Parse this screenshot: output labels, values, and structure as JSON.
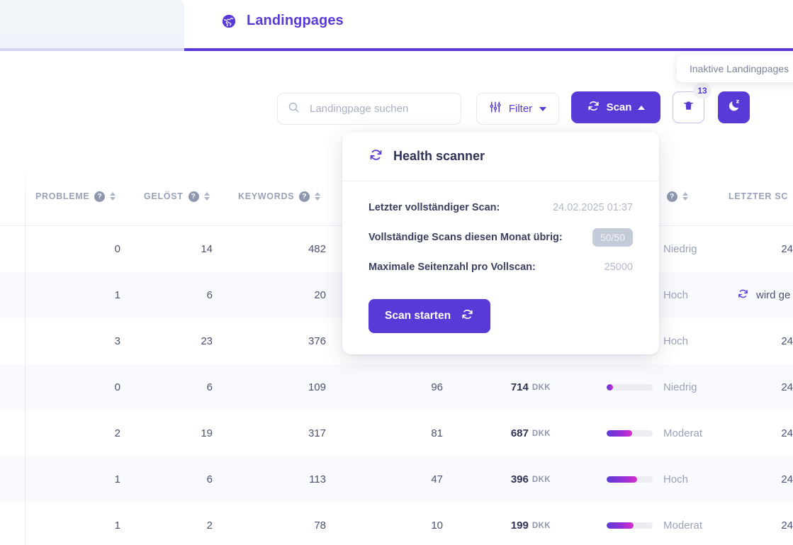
{
  "tabs": {
    "active": {
      "title": "Landingpages",
      "icon": "globe-icon"
    },
    "inactive": {
      "title": ""
    }
  },
  "tooltip": {
    "text": "Inaktive Landingpages"
  },
  "toolbar": {
    "search": {
      "value": "",
      "placeholder": "Landingpage suchen",
      "icon": "search-icon"
    },
    "filter": {
      "label": "Filter",
      "icon": "sliders-icon"
    },
    "scan": {
      "label": "Scan",
      "icon": "refresh-icon"
    },
    "trash": {
      "icon": "trash-icon",
      "badge": "13"
    },
    "sleep": {
      "icon": "moon-icon"
    }
  },
  "health_panel": {
    "title": "Health scanner",
    "icon": "refresh-icon",
    "rows": [
      {
        "label": "Letzter vollständiger Scan:",
        "value": "24.02.2025 01:37",
        "pill": false
      },
      {
        "label": "Vollständige Scans diesen Monat übrig:",
        "value": "50/50",
        "pill": true
      },
      {
        "label": "Maximale Seitenzahl pro Vollscan:",
        "value": "25000",
        "pill": false
      }
    ],
    "cta": {
      "label": "Scan starten",
      "icon": "refresh-icon"
    }
  },
  "table": {
    "columns": [
      {
        "key": "probleme",
        "label": "PROBLEME",
        "help": true,
        "sortable": true
      },
      {
        "key": "geloest",
        "label": "GELÖST",
        "help": true,
        "sortable": true
      },
      {
        "key": "keywords",
        "label": "KEYWORDS",
        "help": true,
        "sortable": true
      },
      {
        "key": "hidden1",
        "label": "",
        "help": false,
        "sortable": false
      },
      {
        "key": "hidden2",
        "label": "",
        "help": false,
        "sortable": false
      },
      {
        "key": "potenzial",
        "label": "",
        "help": true,
        "sortable": true
      },
      {
        "key": "letzter_scan",
        "label": "LETZTER SC",
        "help": false,
        "sortable": false
      }
    ],
    "rows": [
      {
        "probleme": "0",
        "geloest": "14",
        "keywords": "482",
        "count": "",
        "price": "",
        "currency": "",
        "bar": 0,
        "level": "Niedrig",
        "date": "24",
        "scanning": false
      },
      {
        "probleme": "1",
        "geloest": "6",
        "keywords": "20",
        "count": "",
        "price": "",
        "currency": "",
        "bar": 0,
        "level": "Hoch",
        "date": "",
        "scanning": true,
        "scanning_text": "wird ge"
      },
      {
        "probleme": "3",
        "geloest": "23",
        "keywords": "376",
        "count": "",
        "price": "",
        "currency": "",
        "bar": 0,
        "level": "Hoch",
        "date": "24",
        "scanning": false
      },
      {
        "probleme": "0",
        "geloest": "6",
        "keywords": "109",
        "count": "96",
        "price": "714",
        "currency": "DKK",
        "bar": 14,
        "level": "Niedrig",
        "date": "24",
        "scanning": false
      },
      {
        "probleme": "2",
        "geloest": "19",
        "keywords": "317",
        "count": "81",
        "price": "687",
        "currency": "DKK",
        "bar": 56,
        "level": "Moderat",
        "date": "24",
        "scanning": false
      },
      {
        "probleme": "1",
        "geloest": "6",
        "keywords": "113",
        "count": "47",
        "price": "396",
        "currency": "DKK",
        "bar": 66,
        "level": "Hoch",
        "date": "24",
        "scanning": false
      },
      {
        "probleme": "1",
        "geloest": "2",
        "keywords": "78",
        "count": "10",
        "price": "199",
        "currency": "DKK",
        "bar": 59,
        "level": "Moderat",
        "date": "24",
        "scanning": false
      }
    ]
  },
  "colors": {
    "brand": "#5a3ad6",
    "bar_gradient_start": "#5a3ad6",
    "bar_gradient_end": "#d92ecb",
    "text_muted": "#9aa2b8"
  }
}
